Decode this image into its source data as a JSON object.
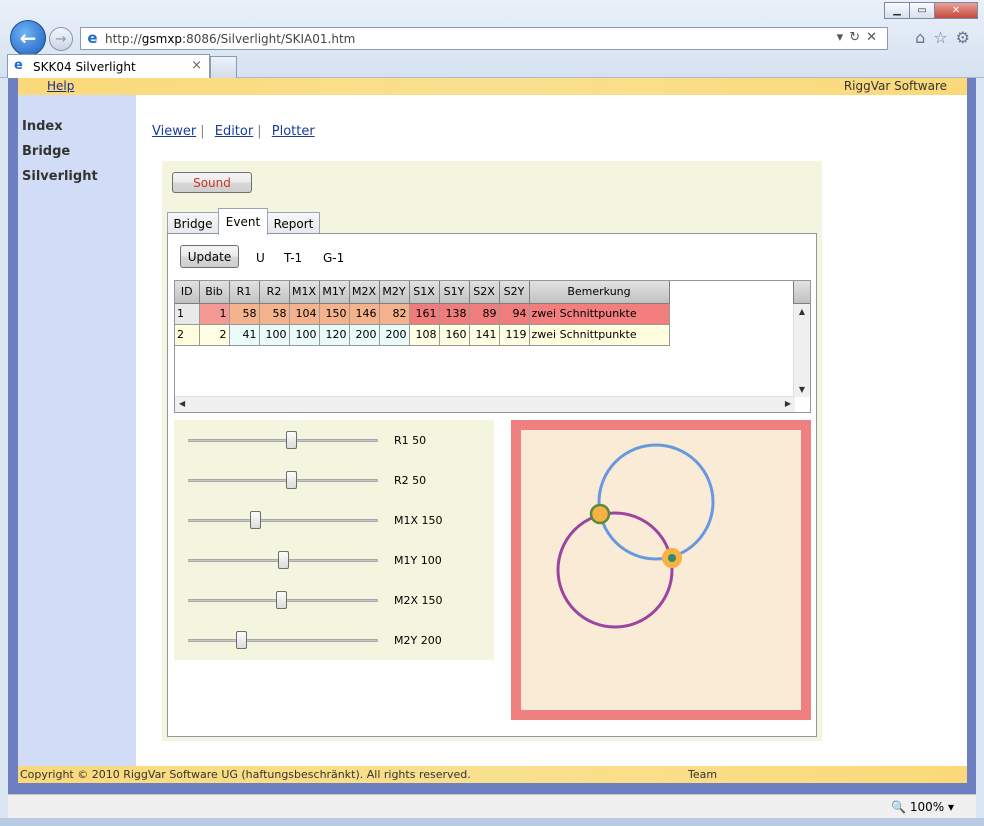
{
  "browser": {
    "url_prefix": "http://",
    "url_host": "gsmxp",
    "url_rest": ":8086/Silverlight/SKIA01.htm",
    "tab_title": "SKK04 Silverlight",
    "tab_close": "×",
    "zoom": "100%",
    "icons": [
      "back-arrow-icon",
      "forward-arrow-icon",
      "ie-logo-icon",
      "home-icon",
      "star-icon",
      "gear-icon"
    ]
  },
  "page": {
    "help_link": "Help",
    "brand": "RiggVar Software",
    "sidebar": [
      "Index",
      "Bridge",
      "Silverlight"
    ],
    "top_links": [
      "Viewer",
      "Editor",
      "Plotter"
    ],
    "footer_copy": "Copyright © 2010 RiggVar Software UG (haftungsbeschränkt). All rights reserved.",
    "footer_team": "Team"
  },
  "app": {
    "sound_label": "Sound",
    "tabs": [
      "Bridge",
      "Event",
      "Report"
    ],
    "selected_tab": "Event",
    "update_label": "Update",
    "event_labels": [
      "U",
      "T-1",
      "G-1"
    ],
    "grid": {
      "columns": [
        "ID",
        "Bib",
        "R1",
        "R2",
        "M1X",
        "M1Y",
        "M2X",
        "M2Y",
        "S1X",
        "S1Y",
        "S2X",
        "S2Y",
        "Bemerkung"
      ],
      "rows": [
        [
          "1",
          "1",
          "58",
          "58",
          "104",
          "150",
          "146",
          "82",
          "161",
          "138",
          "89",
          "94",
          "zwei Schnittpunkte"
        ],
        [
          "2",
          "2",
          "41",
          "100",
          "100",
          "120",
          "200",
          "200",
          "108",
          "160",
          "141",
          "119",
          "zwei Schnittpunkte"
        ]
      ]
    },
    "sliders": [
      {
        "label": "R1 50",
        "fraction": 0.54
      },
      {
        "label": "R2 50",
        "fraction": 0.54
      },
      {
        "label": "M1X 150",
        "fraction": 0.35
      },
      {
        "label": "M1Y 100",
        "fraction": 0.5
      },
      {
        "label": "M2X 150",
        "fraction": 0.49
      },
      {
        "label": "M2Y 200",
        "fraction": 0.28
      }
    ],
    "plot": {
      "border_color": "#ee8080",
      "background_color": "#faebd7",
      "circle1_color": "#6699e0",
      "circle2_color": "#9b45a0",
      "marker_color": "#f6b343"
    }
  }
}
